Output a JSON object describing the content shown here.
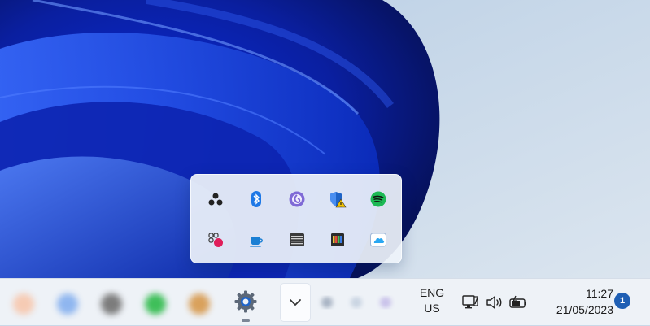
{
  "tray_overflow": {
    "items": [
      {
        "icon": "three-dots-cluster-icon"
      },
      {
        "icon": "bluetooth-icon"
      },
      {
        "icon": "bittorrent-icon"
      },
      {
        "icon": "windows-security-warning-icon"
      },
      {
        "icon": "spotify-icon"
      },
      {
        "icon": "slack-icon"
      },
      {
        "icon": "coffee-cup-icon"
      },
      {
        "icon": "keyboard-app-icon"
      },
      {
        "icon": "color-bars-app-icon"
      },
      {
        "icon": "onedrive-icon"
      }
    ]
  },
  "taskbar": {
    "pinned": [
      {
        "icon": "settings-gear-icon"
      }
    ],
    "show_hidden_icons": {
      "icon": "chevron-up-icon"
    },
    "language": {
      "line1": "ENG",
      "line2": "US"
    },
    "system_icons": [
      "network-icon",
      "volume-icon",
      "battery-icon"
    ],
    "clock": {
      "time": "11:27",
      "date": "21/05/2023"
    },
    "notifications": {
      "count": "1"
    }
  },
  "colors": {
    "wallpaper_bg": "#c9d8e8",
    "bloom_dark": "#0a1fa0",
    "bloom_mid": "#1f4fe0",
    "accent": "#1f5fb4",
    "taskbar_bg": "#eef2f7"
  }
}
